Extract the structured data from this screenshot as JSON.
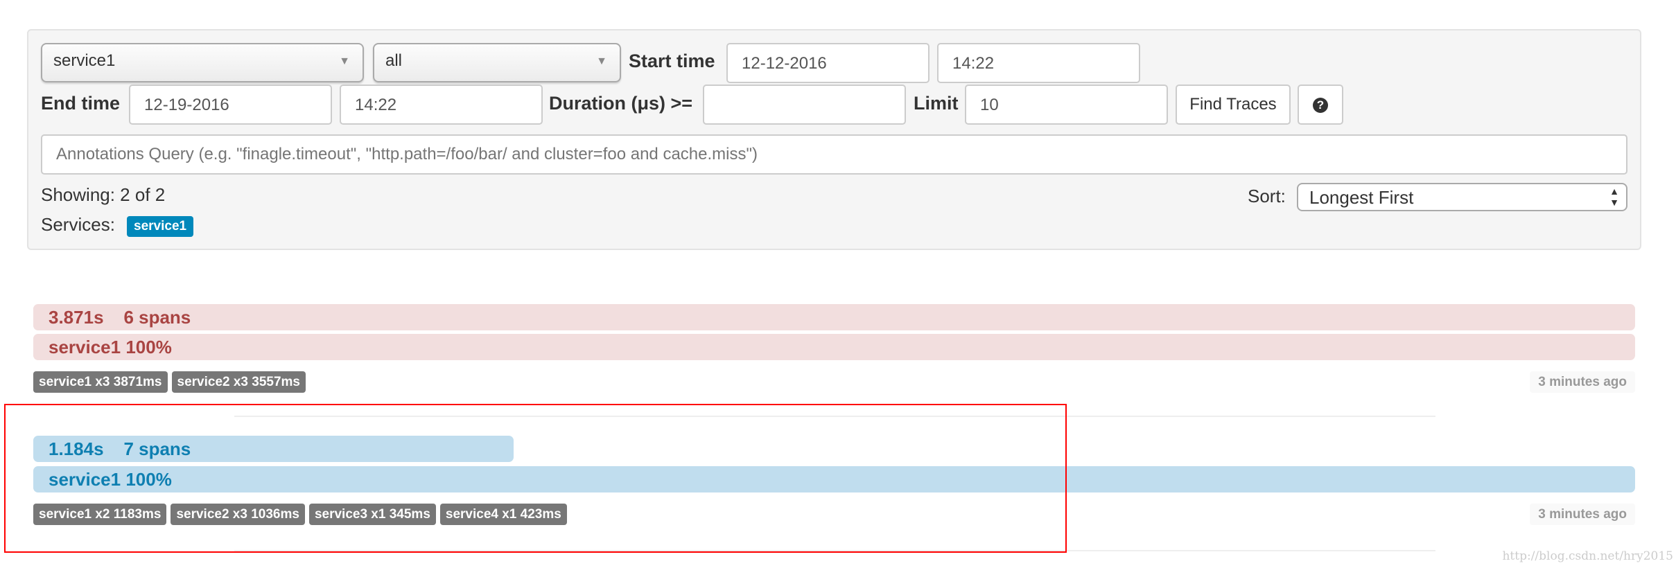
{
  "search": {
    "service_select": "service1",
    "span_select": "all",
    "start_time_label": "Start time",
    "start_date": "12-12-2016",
    "start_time": "14:22",
    "end_time_label": "End time",
    "end_date": "12-19-2016",
    "end_time": "14:22",
    "duration_label": "Duration (μs) >=",
    "duration_value": "",
    "limit_label": "Limit",
    "limit_value": "10",
    "find_button": "Find Traces",
    "help_icon": "question-circle-icon",
    "annotations_placeholder": "Annotations Query (e.g. \"finagle.timeout\", \"http.path=/foo/bar/ and cluster=foo and cache.miss\")",
    "showing": "Showing: 2 of 2",
    "services_label": "Services:",
    "services": [
      "service1"
    ],
    "sort_label": "Sort:",
    "sort_value": "Longest First"
  },
  "colors": {
    "slow": "#f2dede",
    "fast": "#c0ddee",
    "badge": "#777777",
    "service_tag": "#0088bb",
    "highlight": "#ff0000"
  },
  "traces": [
    {
      "duration": "3.871s",
      "spans": "6 spans",
      "service": "service1 100%",
      "duration_fraction": 1.0,
      "badges": [
        "service1 x3 3871ms",
        "service2 x3 3557ms"
      ],
      "time": "3 minutes ago"
    },
    {
      "duration": "1.184s",
      "spans": "7 spans",
      "service": "service1 100%",
      "duration_fraction": 0.306,
      "badges": [
        "service1 x2 1183ms",
        "service2 x3 1036ms",
        "service3 x1 345ms",
        "service4 x1 423ms"
      ],
      "time": "3 minutes ago"
    }
  ],
  "watermark": "http://blog.csdn.net/hry2015"
}
